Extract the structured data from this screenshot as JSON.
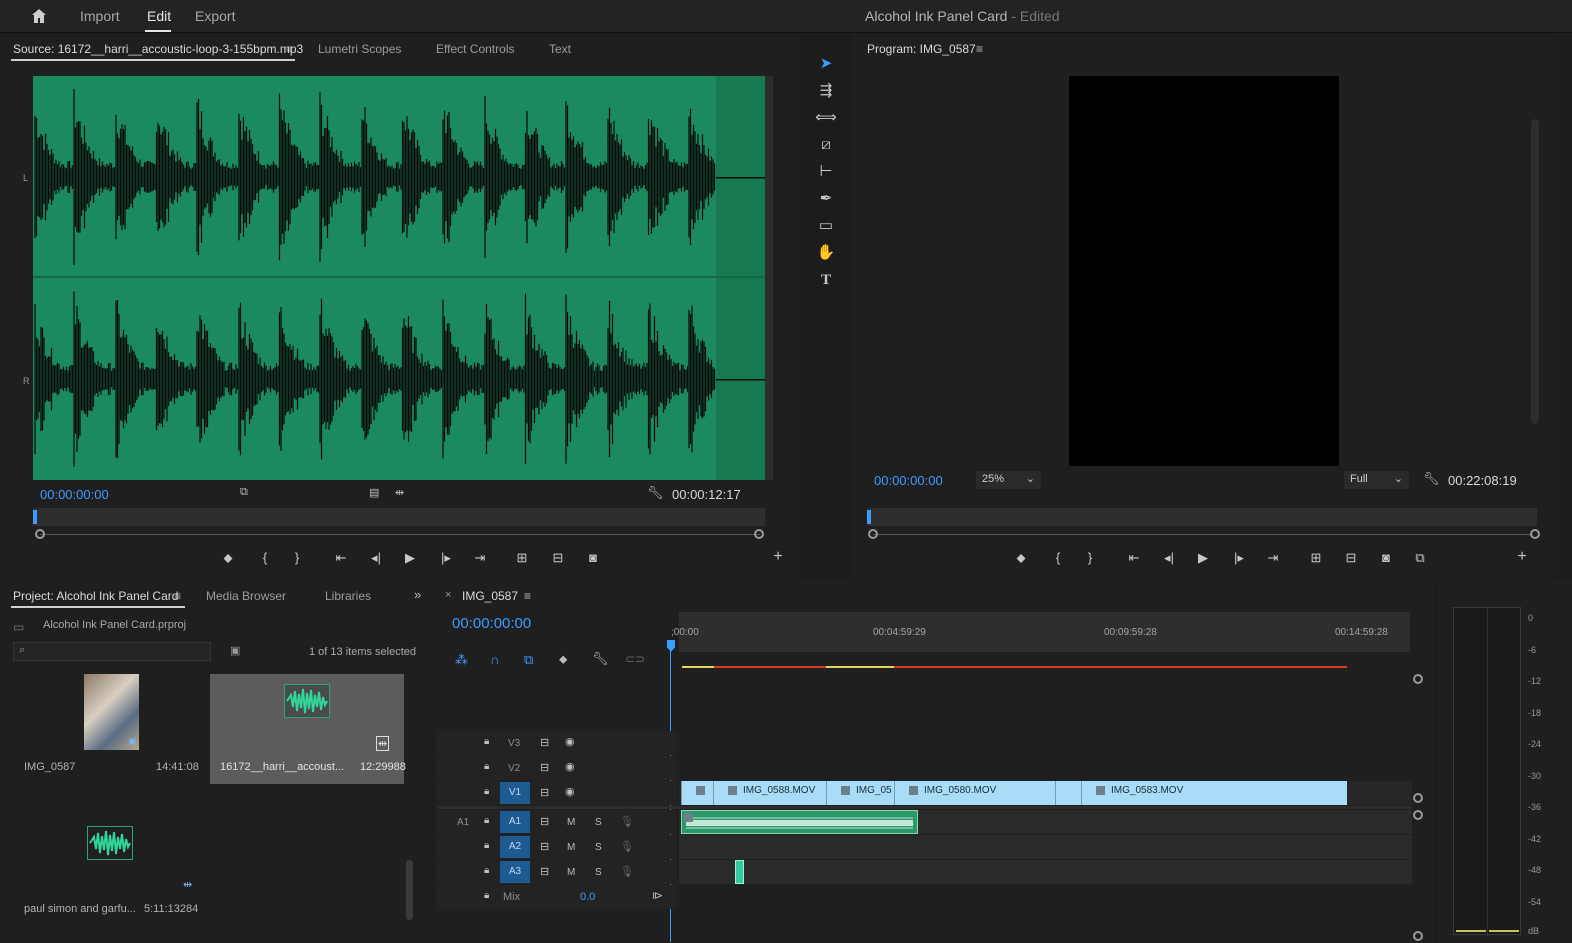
{
  "topbar": {
    "nav": [
      "Import",
      "Edit",
      "Export"
    ],
    "title": "Alcohol Ink Panel Card",
    "edited": "- Edited"
  },
  "source": {
    "tabs": [
      "Source: 16172__harri__accoustic-loop-3-155bpm.mp3",
      "Lumetri Scopes",
      "Effect Controls",
      "Text"
    ],
    "channel_left": "L",
    "channel_right": "R",
    "timecode_in": "00:00:00:00",
    "duration": "00:00:12:17"
  },
  "program": {
    "tab": "Program: IMG_0587",
    "timecode_in": "00:00:00:00",
    "zoom": "25%",
    "resolution": "Full",
    "duration": "00:22:08:19"
  },
  "project": {
    "tabs": [
      "Project: Alcohol Ink Panel Card",
      "Media Browser",
      "Libraries"
    ],
    "file": "Alcohol Ink Panel Card.prproj",
    "selection": "1 of 13 items selected",
    "items": [
      {
        "name": "IMG_0587",
        "duration": "14:41:08"
      },
      {
        "name": "16172__harri__accoust...",
        "duration": "12:29988"
      },
      {
        "name": "paul simon and garfu...",
        "duration": "5:11:13284"
      }
    ]
  },
  "timeline": {
    "tab": "IMG_0587",
    "timecode": "00:00:00:00",
    "ruler": [
      ";00:00",
      "00:04:59:29",
      "00:09:59:28",
      "00:14:59:28"
    ],
    "video_tracks": [
      "V3",
      "V2",
      "V1"
    ],
    "audio_tracks": [
      "A1",
      "A2",
      "A3"
    ],
    "source_patch": "A1",
    "mix_label": "Mix",
    "mix_value": "0.0",
    "mute": "M",
    "solo": "S",
    "clips": [
      "IMG_0588.MOV",
      "IMG_05",
      "IMG_0580.MOV",
      "IMG_0583.MOV"
    ]
  },
  "meter": {
    "labels": [
      "0",
      "-6",
      "-12",
      "-18",
      "-24",
      "-30",
      "-36",
      "-42",
      "-48",
      "-54",
      "dB"
    ]
  },
  "colors": {
    "accent_blue": "#3b9cff",
    "waveform_bg": "#1b8a5e",
    "clip_video": "#a9dcf6",
    "clip_audio": "#2a9a6a"
  }
}
